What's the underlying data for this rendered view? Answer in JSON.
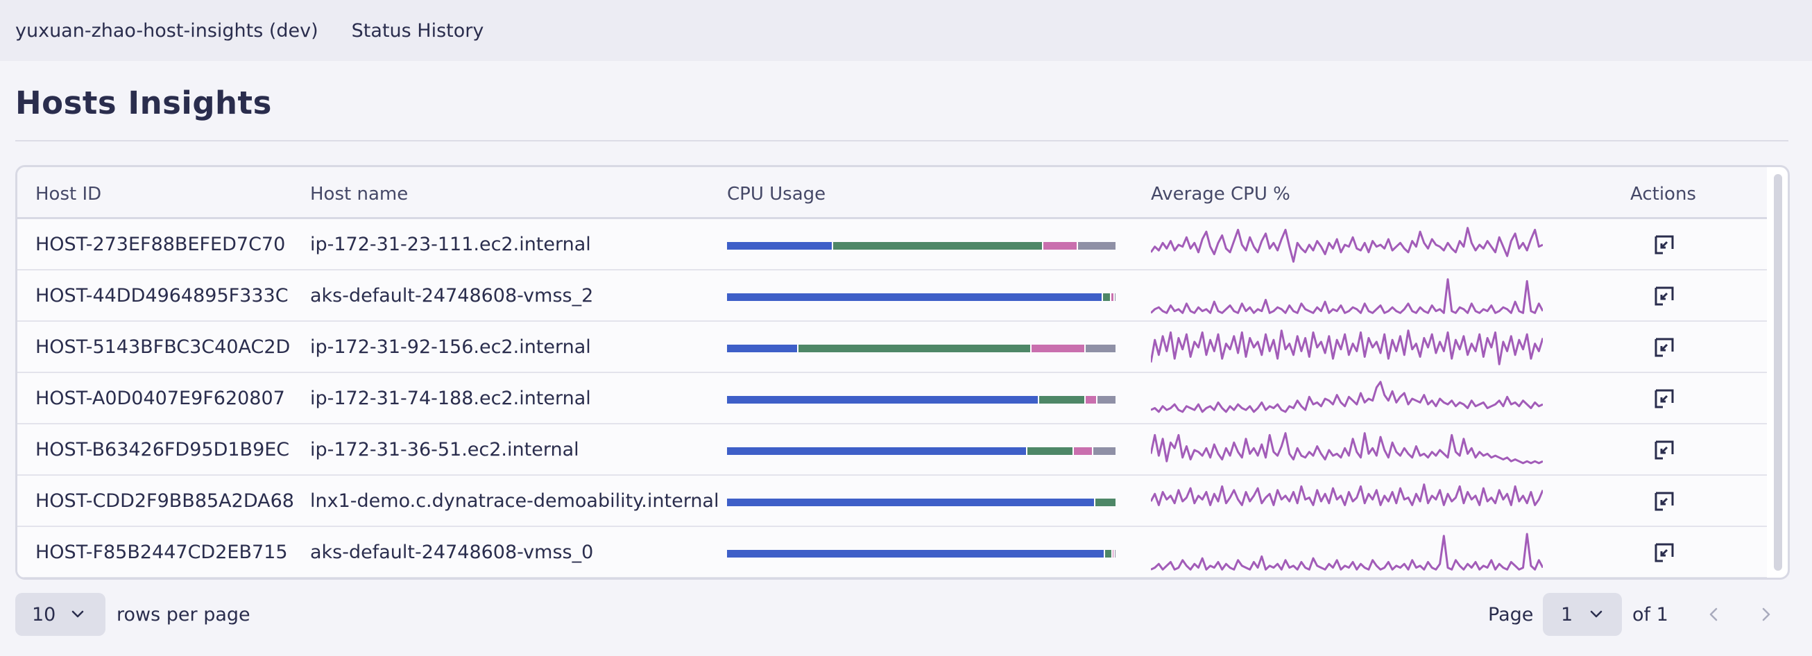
{
  "topbar": {
    "app_name": "yuxuan-zhao-host-insights (dev)",
    "tab_status_history": "Status History"
  },
  "page": {
    "title": "Hosts Insights"
  },
  "table": {
    "columns": {
      "host_id": "Host ID",
      "host_name": "Host name",
      "cpu_usage": "CPU Usage",
      "avg_cpu": "Average CPU %",
      "actions": "Actions"
    },
    "rows": [
      {
        "host_id": "HOST-273EF88BEFED7C70",
        "host_name": "ip-172-31-23-111.ec2.internal",
        "cpu_segments": [
          0.27,
          0.54,
          0.09,
          0.1
        ],
        "spark": [
          0.3,
          0.45,
          0.35,
          0.55,
          0.4,
          0.6,
          0.35,
          0.5,
          0.45,
          0.7,
          0.4,
          0.55,
          0.3,
          0.65,
          0.85,
          0.45,
          0.25,
          0.55,
          0.75,
          0.4,
          0.3,
          0.6,
          0.9,
          0.5,
          0.35,
          0.7,
          0.45,
          0.3,
          0.6,
          0.8,
          0.4,
          0.55,
          0.35,
          0.65,
          0.9,
          0.45,
          0.05,
          0.55,
          0.4,
          0.3,
          0.5,
          0.35,
          0.6,
          0.45,
          0.25,
          0.55,
          0.4,
          0.65,
          0.3,
          0.5,
          0.45,
          0.7,
          0.4,
          0.35,
          0.55,
          0.3,
          0.6,
          0.45,
          0.5,
          0.4,
          0.65,
          0.35,
          0.45,
          0.55,
          0.4,
          0.3,
          0.6,
          0.45,
          0.85,
          0.55,
          0.4,
          0.65,
          0.5,
          0.45,
          0.35,
          0.55,
          0.4,
          0.3,
          0.6,
          0.45,
          0.95,
          0.55,
          0.35,
          0.5,
          0.4,
          0.6,
          0.45,
          0.3,
          0.7,
          0.45,
          0.2,
          0.6,
          0.8,
          0.4,
          0.55,
          0.35,
          0.65,
          0.9,
          0.45,
          0.5
        ]
      },
      {
        "host_id": "HOST-44DD4964895F333C",
        "host_name": "aks-default-24748608-vmss_2",
        "cpu_segments": [
          0.965,
          0.02,
          0.01,
          0.005
        ],
        "spark": [
          0.05,
          0.15,
          0.2,
          0.1,
          0.05,
          0.25,
          0.1,
          0.15,
          0.05,
          0.3,
          0.1,
          0.05,
          0.2,
          0.1,
          0.15,
          0.05,
          0.35,
          0.1,
          0.05,
          0.15,
          0.25,
          0.1,
          0.05,
          0.3,
          0.1,
          0.2,
          0.05,
          0.15,
          0.1,
          0.4,
          0.05,
          0.1,
          0.2,
          0.15,
          0.05,
          0.25,
          0.1,
          0.05,
          0.3,
          0.15,
          0.1,
          0.05,
          0.2,
          0.1,
          0.35,
          0.05,
          0.15,
          0.1,
          0.25,
          0.05,
          0.1,
          0.2,
          0.15,
          0.05,
          0.3,
          0.1,
          0.05,
          0.15,
          0.25,
          0.05,
          0.1,
          0.2,
          0.1,
          0.05,
          0.15,
          0.3,
          0.1,
          0.05,
          0.2,
          0.1,
          0.05,
          0.25,
          0.1,
          0.15,
          0.05,
          0.95,
          0.1,
          0.05,
          0.2,
          0.15,
          0.05,
          0.3,
          0.1,
          0.05,
          0.15,
          0.1,
          0.25,
          0.05,
          0.1,
          0.2,
          0.15,
          0.05,
          0.35,
          0.1,
          0.05,
          0.9,
          0.1,
          0.05,
          0.3,
          0.1
        ]
      },
      {
        "host_id": "HOST-5143BFBC3C40AC2D",
        "host_name": "ip-172-31-92-156.ec2.internal",
        "cpu_segments": [
          0.18,
          0.6,
          0.14,
          0.08
        ],
        "spark": [
          0.1,
          0.7,
          0.3,
          0.8,
          0.4,
          0.9,
          0.2,
          0.75,
          0.45,
          0.85,
          0.25,
          0.65,
          0.5,
          0.9,
          0.3,
          0.7,
          0.4,
          0.85,
          0.2,
          0.6,
          0.45,
          0.8,
          0.35,
          0.9,
          0.25,
          0.75,
          0.5,
          0.65,
          0.3,
          0.85,
          0.4,
          0.7,
          0.2,
          0.95,
          0.45,
          0.6,
          0.3,
          0.8,
          0.4,
          0.75,
          0.25,
          0.9,
          0.5,
          0.65,
          0.35,
          0.8,
          0.2,
          0.7,
          0.45,
          0.85,
          0.3,
          0.6,
          0.4,
          0.9,
          0.25,
          0.75,
          0.5,
          0.65,
          0.35,
          0.85,
          0.2,
          0.7,
          0.4,
          0.8,
          0.3,
          0.95,
          0.45,
          0.6,
          0.25,
          0.75,
          0.5,
          0.85,
          0.35,
          0.65,
          0.4,
          0.9,
          0.2,
          0.7,
          0.45,
          0.8,
          0.3,
          0.6,
          0.4,
          0.85,
          0.25,
          0.75,
          0.5,
          0.9,
          0.05,
          0.65,
          0.4,
          0.8,
          0.3,
          0.7,
          0.45,
          0.85,
          0.2,
          0.6,
          0.4,
          0.75
        ]
      },
      {
        "host_id": "HOST-A0D0407E9F620807",
        "host_name": "ip-172-31-74-188.ec2.internal",
        "cpu_segments": [
          0.8,
          0.12,
          0.03,
          0.05
        ],
        "spark": [
          0.2,
          0.25,
          0.15,
          0.3,
          0.2,
          0.25,
          0.35,
          0.2,
          0.15,
          0.3,
          0.25,
          0.2,
          0.35,
          0.15,
          0.25,
          0.3,
          0.2,
          0.4,
          0.25,
          0.15,
          0.3,
          0.2,
          0.35,
          0.25,
          0.2,
          0.3,
          0.15,
          0.25,
          0.4,
          0.2,
          0.3,
          0.25,
          0.35,
          0.2,
          0.15,
          0.3,
          0.25,
          0.45,
          0.3,
          0.2,
          0.55,
          0.35,
          0.4,
          0.3,
          0.5,
          0.45,
          0.35,
          0.6,
          0.4,
          0.3,
          0.55,
          0.45,
          0.35,
          0.65,
          0.4,
          0.5,
          0.45,
          0.8,
          0.95,
          0.6,
          0.45,
          0.7,
          0.4,
          0.55,
          0.65,
          0.35,
          0.5,
          0.45,
          0.4,
          0.6,
          0.35,
          0.45,
          0.3,
          0.5,
          0.4,
          0.35,
          0.45,
          0.3,
          0.4,
          0.35,
          0.25,
          0.45,
          0.3,
          0.35,
          0.4,
          0.25,
          0.3,
          0.35,
          0.45,
          0.3,
          0.55,
          0.35,
          0.4,
          0.3,
          0.45,
          0.35,
          0.25,
          0.4,
          0.3,
          0.35
        ]
      },
      {
        "host_id": "HOST-B63426FD95D1B9EC",
        "host_name": "ip-172-31-36-51.ec2.internal",
        "cpu_segments": [
          0.77,
          0.12,
          0.05,
          0.06
        ],
        "spark": [
          0.4,
          0.9,
          0.35,
          0.8,
          0.2,
          0.7,
          0.55,
          0.9,
          0.3,
          0.6,
          0.25,
          0.5,
          0.45,
          0.35,
          0.55,
          0.3,
          0.65,
          0.4,
          0.25,
          0.55,
          0.35,
          0.7,
          0.45,
          0.3,
          0.8,
          0.4,
          0.55,
          0.35,
          0.65,
          0.3,
          0.9,
          0.45,
          0.35,
          0.6,
          0.95,
          0.4,
          0.25,
          0.55,
          0.35,
          0.3,
          0.45,
          0.35,
          0.6,
          0.4,
          0.25,
          0.5,
          0.35,
          0.4,
          0.3,
          0.55,
          0.35,
          0.8,
          0.45,
          0.3,
          0.95,
          0.4,
          0.55,
          0.35,
          0.85,
          0.5,
          0.3,
          0.7,
          0.45,
          0.35,
          0.55,
          0.4,
          0.3,
          0.6,
          0.35,
          0.4,
          0.3,
          0.45,
          0.35,
          0.5,
          0.4,
          0.3,
          0.9,
          0.45,
          0.35,
          0.8,
          0.4,
          0.55,
          0.3,
          0.45,
          0.35,
          0.4,
          0.3,
          0.35,
          0.3,
          0.25,
          0.3,
          0.2,
          0.25,
          0.2,
          0.15,
          0.2,
          0.15,
          0.2,
          0.15,
          0.2
        ]
      },
      {
        "host_id": "HOST-CDD2F9BB85A2DA68",
        "host_name": "lnx1-demo.c.dynatrace-demoability.internal",
        "cpu_segments": [
          0.945,
          0.055,
          0.0,
          0.0
        ],
        "spark": [
          0.5,
          0.7,
          0.4,
          0.75,
          0.55,
          0.65,
          0.45,
          0.8,
          0.5,
          0.6,
          0.85,
          0.45,
          0.65,
          0.55,
          0.75,
          0.4,
          0.7,
          0.5,
          0.9,
          0.45,
          0.6,
          0.8,
          0.55,
          0.4,
          0.75,
          0.5,
          0.65,
          0.85,
          0.45,
          0.6,
          0.7,
          0.4,
          0.8,
          0.55,
          0.65,
          0.5,
          0.75,
          0.45,
          0.9,
          0.55,
          0.6,
          0.4,
          0.8,
          0.5,
          0.7,
          0.45,
          0.85,
          0.55,
          0.65,
          0.4,
          0.75,
          0.5,
          0.6,
          0.9,
          0.45,
          0.7,
          0.55,
          0.8,
          0.4,
          0.65,
          0.5,
          0.75,
          0.45,
          0.85,
          0.55,
          0.6,
          0.4,
          0.7,
          0.5,
          0.95,
          0.45,
          0.65,
          0.55,
          0.8,
          0.4,
          0.7,
          0.5,
          0.6,
          0.9,
          0.45,
          0.75,
          0.55,
          0.65,
          0.4,
          0.85,
          0.5,
          0.6,
          0.45,
          0.8,
          0.55,
          0.7,
          0.4,
          0.9,
          0.5,
          0.65,
          0.45,
          0.75,
          0.4,
          0.55,
          0.8
        ]
      },
      {
        "host_id": "HOST-F85B2447CD2EB715",
        "host_name": "aks-default-24748608-vmss_0",
        "cpu_segments": [
          0.97,
          0.02,
          0.005,
          0.005
        ],
        "spark": [
          0.05,
          0.1,
          0.2,
          0.05,
          0.15,
          0.25,
          0.05,
          0.1,
          0.3,
          0.15,
          0.05,
          0.2,
          0.1,
          0.35,
          0.05,
          0.15,
          0.1,
          0.25,
          0.05,
          0.2,
          0.1,
          0.05,
          0.3,
          0.15,
          0.1,
          0.05,
          0.25,
          0.1,
          0.4,
          0.05,
          0.15,
          0.1,
          0.2,
          0.05,
          0.3,
          0.1,
          0.15,
          0.05,
          0.25,
          0.1,
          0.05,
          0.35,
          0.15,
          0.1,
          0.05,
          0.2,
          0.1,
          0.3,
          0.05,
          0.15,
          0.1,
          0.25,
          0.05,
          0.2,
          0.1,
          0.05,
          0.3,
          0.15,
          0.05,
          0.1,
          0.25,
          0.05,
          0.15,
          0.1,
          0.2,
          0.05,
          0.3,
          0.1,
          0.15,
          0.05,
          0.25,
          0.1,
          0.05,
          0.2,
          0.95,
          0.1,
          0.05,
          0.3,
          0.15,
          0.05,
          0.2,
          0.1,
          0.25,
          0.05,
          0.15,
          0.1,
          0.3,
          0.05,
          0.2,
          0.1,
          0.05,
          0.25,
          0.15,
          0.05,
          0.1,
          1.0,
          0.15,
          0.05,
          0.3,
          0.1
        ]
      }
    ]
  },
  "colors": {
    "segments": [
      "#3e5fc8",
      "#4e8767",
      "#c96fae",
      "#8f90a6"
    ],
    "spark": "#a25cb8"
  },
  "pagination": {
    "rows_per_page_value": "10",
    "rows_per_page_label": "rows per page",
    "page_label": "Page",
    "page_value": "1",
    "of_label": "of 1"
  }
}
